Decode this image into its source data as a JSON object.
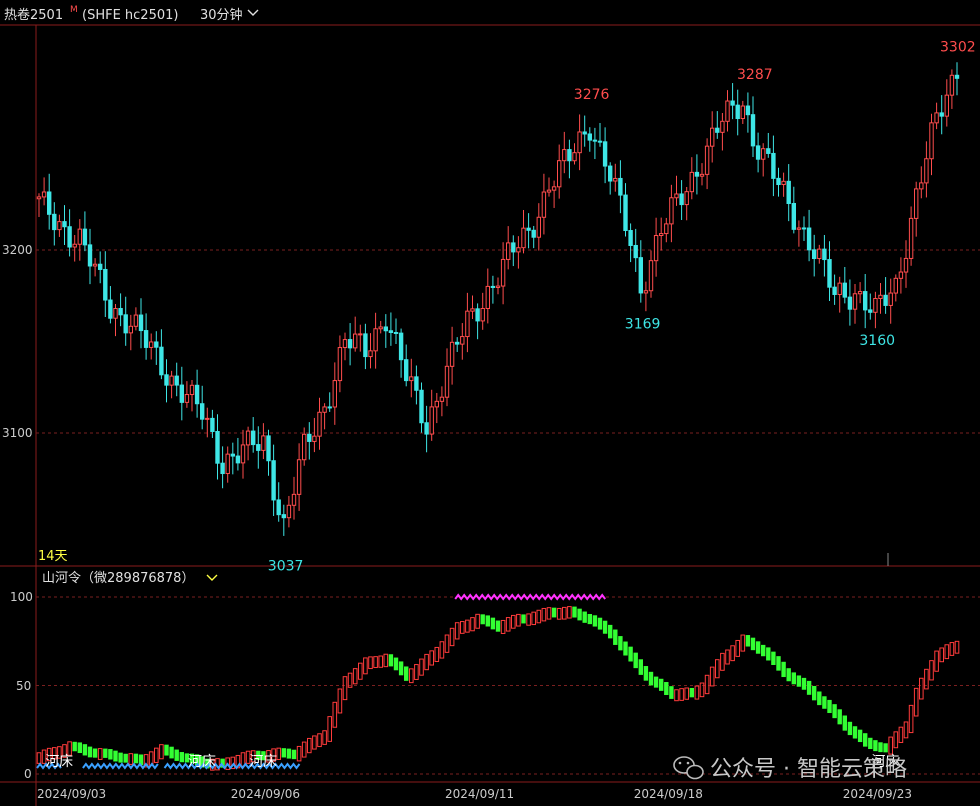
{
  "header": {
    "instrument": "热卷2501",
    "badge": "M",
    "code": "(SHFE hc2501)",
    "period": "30分钟",
    "period_icon": "chevron-down-icon"
  },
  "main_pane": {
    "y_ticks": [
      "3200",
      "3100"
    ],
    "cycle_label": "14天",
    "annotations": [
      {
        "text": "3276",
        "color": "#ff4d4d",
        "x_index": 108
      },
      {
        "text": "3287",
        "color": "#ff4d4d",
        "x_index": 140
      },
      {
        "text": "3302",
        "color": "#ff4d4d",
        "x_index": 180
      },
      {
        "text": "3169",
        "color": "#3ee6e6",
        "x_index": 118
      },
      {
        "text": "3160",
        "color": "#3ee6e6",
        "x_index": 164
      },
      {
        "text": "3037",
        "color": "#3ee6e6",
        "x_index": 48
      }
    ]
  },
  "indicator_pane": {
    "title": "山河令（微289876878）",
    "title_icon": "chevron-down-icon",
    "y_ticks": [
      "100",
      "50",
      "0"
    ],
    "riverbed_labels": [
      {
        "text": "河床",
        "x_index": 2
      },
      {
        "text": "河床",
        "x_index": 30
      },
      {
        "text": "河床",
        "x_index": 42
      },
      {
        "text": "河床",
        "x_index": 164
      }
    ]
  },
  "x_axis": {
    "labels": [
      "2024/09/03",
      "2024/09/06",
      "2024/09/11",
      "2024/09/18",
      "2024/09/23"
    ]
  },
  "watermark": {
    "text": "公众号 · 智能云策略",
    "icon": "wechat-icon"
  },
  "colors": {
    "up": "#ff4d4d",
    "down": "#3ee6e6",
    "osc_up": "#ff3b3b",
    "osc_down": "#33ff33",
    "top_marker": "#ff33ff",
    "bottom_marker": "#3aa0ff",
    "grid": "#7a1f1f"
  },
  "chart_data": [
    {
      "type": "candlestick",
      "title": "热卷2501 (SHFE hc2501) 30分钟",
      "x_labels": [
        "2024/09/03",
        "2024/09/06",
        "2024/09/11",
        "2024/09/18",
        "2024/09/23"
      ],
      "y_ticks": [
        3200,
        3100
      ],
      "ylim": [
        3025,
        3315
      ],
      "key_levels": {
        "high_1": 3276,
        "high_2": 3287,
        "high_3": 3302,
        "low_1": 3037,
        "low_2": 3169,
        "low_3": 3160
      },
      "close_anchors": [
        [
          0,
          3225
        ],
        [
          8,
          3205
        ],
        [
          14,
          3170
        ],
        [
          18,
          3160
        ],
        [
          22,
          3145
        ],
        [
          26,
          3130
        ],
        [
          32,
          3110
        ],
        [
          36,
          3085
        ],
        [
          40,
          3090
        ],
        [
          44,
          3095
        ],
        [
          48,
          3050
        ],
        [
          52,
          3090
        ],
        [
          56,
          3115
        ],
        [
          60,
          3150
        ],
        [
          64,
          3145
        ],
        [
          68,
          3165
        ],
        [
          72,
          3130
        ],
        [
          76,
          3105
        ],
        [
          80,
          3135
        ],
        [
          84,
          3160
        ],
        [
          88,
          3178
        ],
        [
          92,
          3195
        ],
        [
          96,
          3210
        ],
        [
          100,
          3235
        ],
        [
          104,
          3250
        ],
        [
          108,
          3270
        ],
        [
          112,
          3240
        ],
        [
          116,
          3205
        ],
        [
          118,
          3180
        ],
        [
          122,
          3210
        ],
        [
          126,
          3230
        ],
        [
          130,
          3250
        ],
        [
          134,
          3270
        ],
        [
          138,
          3282
        ],
        [
          140,
          3262
        ],
        [
          144,
          3240
        ],
        [
          148,
          3220
        ],
        [
          152,
          3200
        ],
        [
          156,
          3175
        ],
        [
          160,
          3178
        ],
        [
          164,
          3165
        ],
        [
          168,
          3180
        ],
        [
          172,
          3230
        ],
        [
          176,
          3270
        ],
        [
          180,
          3300
        ]
      ]
    },
    {
      "type": "bar",
      "title": "山河令",
      "y_ticks": [
        100,
        50,
        0
      ],
      "ylim": [
        0,
        100
      ],
      "value_anchors": [
        [
          0,
          12
        ],
        [
          6,
          18
        ],
        [
          10,
          15
        ],
        [
          14,
          13
        ],
        [
          20,
          10
        ],
        [
          24,
          16
        ],
        [
          28,
          12
        ],
        [
          32,
          9
        ],
        [
          36,
          8
        ],
        [
          40,
          12
        ],
        [
          46,
          14
        ],
        [
          50,
          14
        ],
        [
          56,
          25
        ],
        [
          60,
          55
        ],
        [
          64,
          65
        ],
        [
          68,
          68
        ],
        [
          72,
          58
        ],
        [
          74,
          62
        ],
        [
          78,
          72
        ],
        [
          82,
          85
        ],
        [
          86,
          90
        ],
        [
          90,
          86
        ],
        [
          94,
          90
        ],
        [
          98,
          92
        ],
        [
          100,
          94
        ],
        [
          104,
          94
        ],
        [
          108,
          90
        ],
        [
          112,
          82
        ],
        [
          116,
          68
        ],
        [
          120,
          55
        ],
        [
          124,
          48
        ],
        [
          128,
          48
        ],
        [
          130,
          52
        ],
        [
          134,
          68
        ],
        [
          138,
          78
        ],
        [
          142,
          72
        ],
        [
          146,
          60
        ],
        [
          150,
          52
        ],
        [
          154,
          42
        ],
        [
          158,
          30
        ],
        [
          162,
          20
        ],
        [
          166,
          17
        ],
        [
          170,
          30
        ],
        [
          172,
          48
        ],
        [
          176,
          70
        ],
        [
          180,
          75
        ]
      ]
    }
  ]
}
